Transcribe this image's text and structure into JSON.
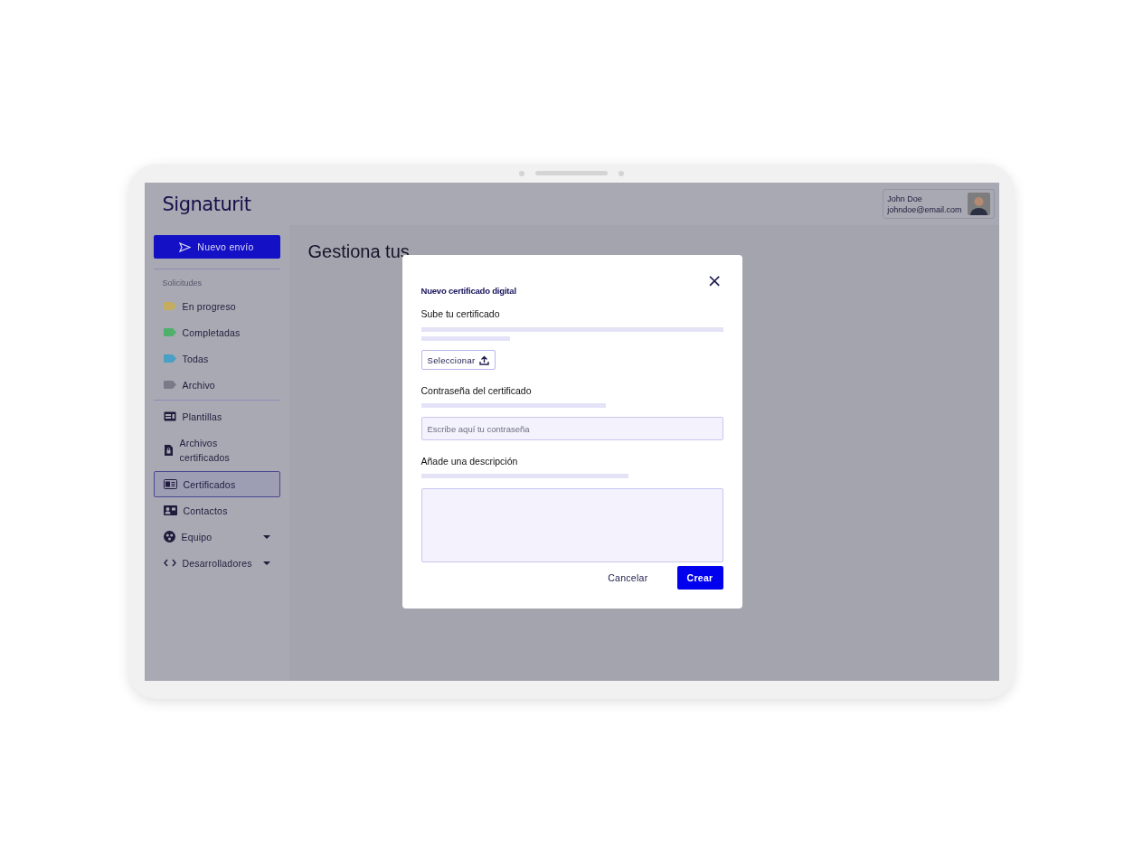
{
  "header": {
    "logo": "Signaturit",
    "user": {
      "name": "John Doe",
      "email": "johndoe@email.com"
    }
  },
  "sidebar": {
    "new_button": "Nuevo envío",
    "section_title": "Solicitudes",
    "requests": [
      {
        "label": "En progreso",
        "color": "#c4ad5e"
      },
      {
        "label": "Completadas",
        "color": "#4fb06c"
      },
      {
        "label": "Todas",
        "color": "#4a9fc4"
      },
      {
        "label": "Archivo",
        "color": "#7a7a88"
      }
    ],
    "items": [
      {
        "label": "Plantillas",
        "kind": "link",
        "selected": false
      },
      {
        "label": "Archivos certificados",
        "kind": "link",
        "selected": false
      },
      {
        "label": "Certificados",
        "kind": "link",
        "selected": true
      },
      {
        "label": "Contactos",
        "kind": "link",
        "selected": false
      },
      {
        "label": "Equipo",
        "kind": "menu",
        "selected": false,
        "expanded": false
      },
      {
        "label": "Desarrolladores",
        "kind": "menu",
        "selected": false,
        "expanded": false
      }
    ]
  },
  "main": {
    "title": "Gestiona tus"
  },
  "dialog": {
    "title": "Nuevo certificado digital",
    "close": "×",
    "upload_label": "Sube tu certificado",
    "select_button": "Seleccionar",
    "password_label": "Contraseña del certificado",
    "password_placeholder": "Escribe aquí tu contraseña",
    "description_label": "Añade una descripción",
    "buttons": [
      {
        "label": "Cancelar",
        "kind": "secondary"
      },
      {
        "label": "Crear",
        "kind": "primary"
      }
    ]
  }
}
